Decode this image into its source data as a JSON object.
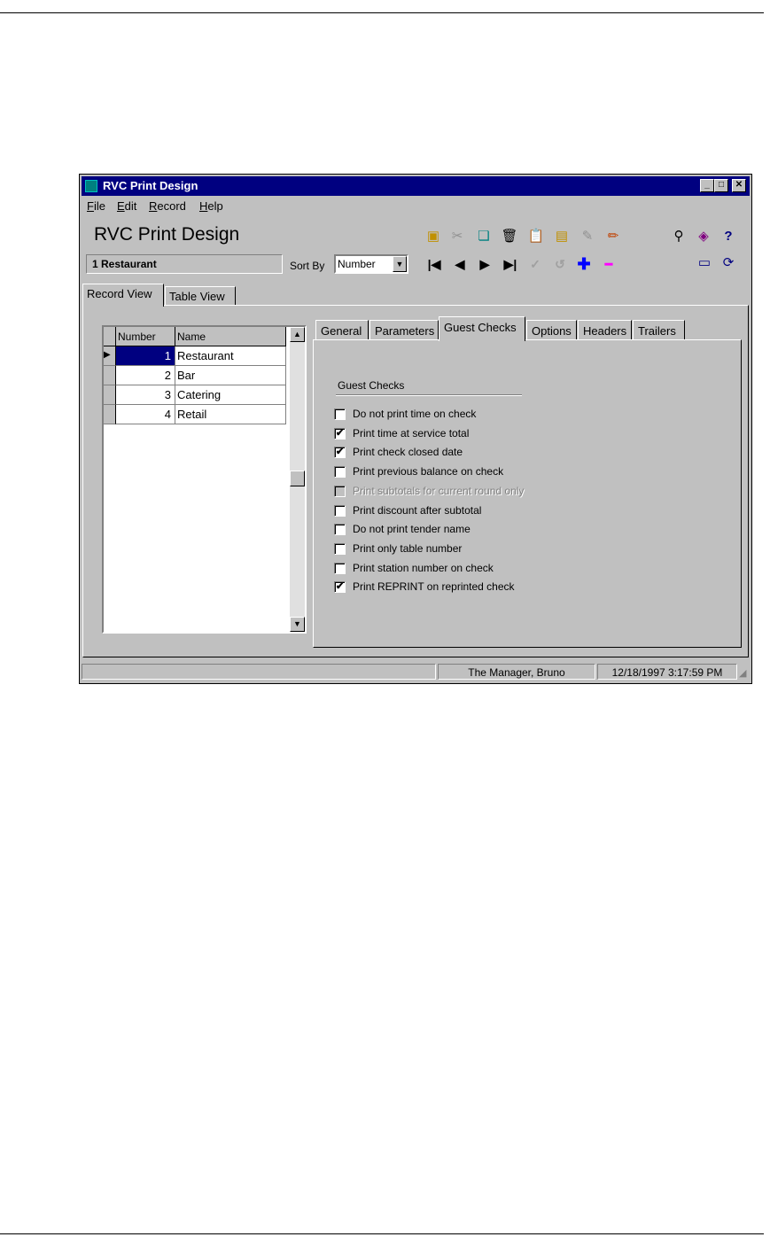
{
  "window": {
    "title": "RVC Print Design",
    "minimize_glyph": "_",
    "maximize_glyph": "□",
    "close_glyph": "✕"
  },
  "menu": [
    "File",
    "Edit",
    "Record",
    "Help"
  ],
  "header": {
    "app_title": "RVC Print Design",
    "current_record": "1 Restaurant",
    "sort_by_label": "Sort By",
    "sort_by_value": "Number"
  },
  "toolbar": {
    "nav": {
      "first": "|◀",
      "prev": "◀",
      "next": "▶",
      "last": "▶|",
      "confirm": "✓",
      "undo": "↺",
      "add": "✚",
      "remove": "━"
    }
  },
  "view_tabs": [
    "Record View",
    "Table View"
  ],
  "grid": {
    "columns": [
      "Number",
      "Name"
    ],
    "rows": [
      {
        "number": "1",
        "name": "Restaurant"
      },
      {
        "number": "2",
        "name": "Bar"
      },
      {
        "number": "3",
        "name": "Catering"
      },
      {
        "number": "4",
        "name": "Retail"
      }
    ]
  },
  "detail_tabs": [
    "General",
    "Parameters",
    "Guest Checks",
    "Options",
    "Headers",
    "Trailers"
  ],
  "guest_checks": {
    "group_label": "Guest Checks",
    "check_glyph": "✔",
    "options": [
      {
        "label": "Do not print time on check",
        "checked": false
      },
      {
        "label": "Print time at service total",
        "checked": true
      },
      {
        "label": "Print check closed date",
        "checked": true
      },
      {
        "label": "Print previous balance on check",
        "checked": false
      },
      {
        "label": "Print subtotals for current round only",
        "checked": false
      },
      {
        "label": "Print discount after subtotal",
        "checked": false
      },
      {
        "label": "Do not print tender name",
        "checked": false
      },
      {
        "label": "Print only table number",
        "checked": false
      },
      {
        "label": "Print station number on check",
        "checked": false
      },
      {
        "label": "Print REPRINT on reprinted check",
        "checked": true
      }
    ]
  },
  "status": {
    "user": "The Manager, Bruno",
    "datetime": "12/18/1997 3:17:59 PM"
  }
}
